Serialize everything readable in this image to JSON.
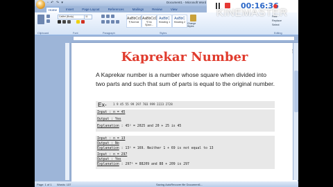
{
  "window": {
    "title": "Document1 - Microsoft Word"
  },
  "quick_access": {
    "items": "▫ ↶ ↷ ▾"
  },
  "ribbon": {
    "tabs": [
      "Home",
      "Insert",
      "Page Layout",
      "References",
      "Mailings",
      "Review",
      "View"
    ],
    "font_name": "Calibri (Body)",
    "font_size": "11",
    "groups": [
      "Clipboard",
      "Font",
      "Paragraph",
      "Styles",
      "Editing"
    ],
    "styles": [
      {
        "label": "¶ Normal"
      },
      {
        "label": "¶ No Spaci..."
      },
      {
        "label": "Heading 1"
      },
      {
        "label": "Heading 2"
      }
    ],
    "editing": [
      "Find",
      "Replace",
      "Select"
    ],
    "change_styles": "Change Styles"
  },
  "recorder": {
    "time": "00:16:36",
    "watermark": "KINEMASTER"
  },
  "document": {
    "heading": "Kaprekar Number",
    "paragraph": "A Kaprekar number is a number whose square when divided into two parts and such that sum of parts is equal to the original number.",
    "example_label": "Ex-",
    "example_sequence": "1 9 45 55 99 297 703 999 2223 2728",
    "blocks": [
      {
        "input": "Input :  n = 45",
        "output": "Output : Yes",
        "explanation_label": "Explanation",
        "explanation": " :  45² = 2025 and 20 + 25 is 45"
      },
      {
        "input": "Input :  n = 13",
        "output": "Output : No",
        "explanation_label": "Explanation",
        "explanation": " :  13² = 169. Neither 1 + 69 is not equal to 13"
      },
      {
        "input": "Input :  n = 297",
        "output": "Output : Yes",
        "explanation_label": "Explanation",
        "explanation": " :  297² = 88209 and 88 + 209 is 297"
      }
    ]
  },
  "status": {
    "page": "Page: 1 of 1",
    "words": "Words: 137",
    "center": "Saving AutoRecover file Document1..."
  }
}
